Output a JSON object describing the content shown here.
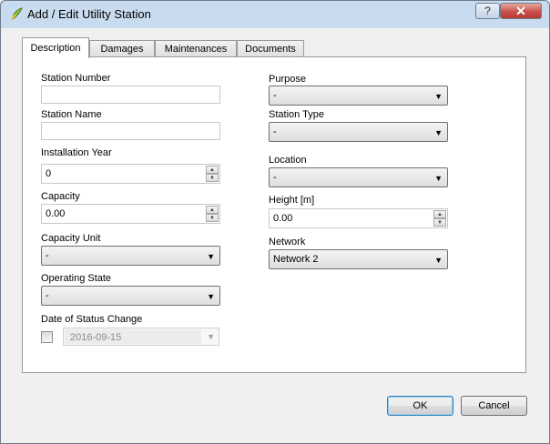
{
  "window": {
    "title": "Add / Edit Utility Station",
    "help_label": "?",
    "close_label": "✕",
    "icon": "qgis-icon"
  },
  "tabs": [
    {
      "label": "Description",
      "active": true
    },
    {
      "label": "Damages",
      "active": false
    },
    {
      "label": "Maintenances",
      "active": false
    },
    {
      "label": "Documents",
      "active": false
    }
  ],
  "form": {
    "station_number": {
      "label": "Station Number",
      "value": ""
    },
    "station_name": {
      "label": "Station Name",
      "value": ""
    },
    "installation_year": {
      "label": "Installation Year",
      "value": "0"
    },
    "capacity": {
      "label": "Capacity",
      "value": "0.00"
    },
    "capacity_unit": {
      "label": "Capacity Unit",
      "value": "-"
    },
    "operating_state": {
      "label": "Operating State",
      "value": "-"
    },
    "date_of_status_change": {
      "label": "Date of Status Change",
      "value": "2016-09-15",
      "checked": false,
      "enabled": false
    },
    "purpose": {
      "label": "Purpose",
      "value": "-"
    },
    "station_type": {
      "label": "Station Type",
      "value": "-"
    },
    "location": {
      "label": "Location",
      "value": "-"
    },
    "height": {
      "label": "Height [m]",
      "value": "0.00"
    },
    "network": {
      "label": "Network",
      "value": "Network 2"
    }
  },
  "buttons": {
    "ok": "OK",
    "cancel": "Cancel"
  }
}
